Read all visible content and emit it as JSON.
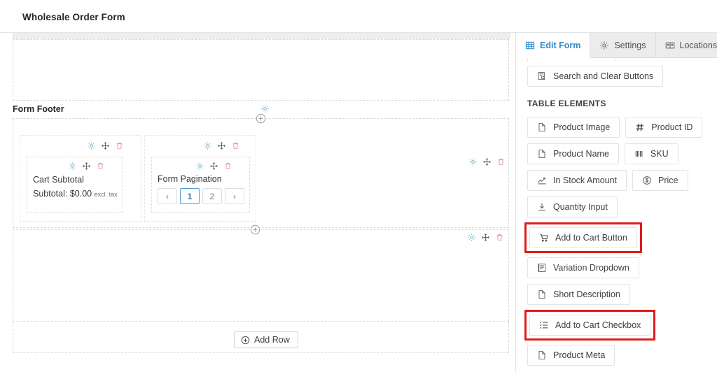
{
  "topbar": {
    "title": "Wholesale Order Form"
  },
  "canvas": {
    "form_footer_label": "Form Footer",
    "cart_subtotal": {
      "title": "Cart Subtotal",
      "value_label": "Subtotal: $0.00",
      "tax_note": "excl. tax"
    },
    "pagination": {
      "title": "Form Pagination",
      "prev": "‹",
      "pages": [
        "1",
        "2"
      ],
      "active_page": "1",
      "next": "›"
    },
    "add_row_label": "Add Row",
    "icons": {
      "settings": "gear-icon",
      "move": "move-icon",
      "delete": "trash-icon",
      "add": "plus-circle-icon"
    }
  },
  "sidebar": {
    "tabs": [
      {
        "label": "Edit Form",
        "icon": "table-grid-icon",
        "active": true
      },
      {
        "label": "Settings",
        "icon": "gear-icon",
        "active": false
      },
      {
        "label": "Locations",
        "icon": "locations-icon",
        "active": false
      }
    ],
    "search_clear_chip": {
      "label": "Search and Clear Buttons",
      "icon": "search-form-icon"
    },
    "table_elements_heading": "TABLE ELEMENTS",
    "elements": [
      {
        "label": "Product Image",
        "icon": "document-icon",
        "highlighted": false
      },
      {
        "label": "Product ID",
        "icon": "hash-icon",
        "highlighted": false
      },
      {
        "label": "Product Name",
        "icon": "document-icon",
        "highlighted": false
      },
      {
        "label": "SKU",
        "icon": "barcode-icon",
        "highlighted": false
      },
      {
        "label": "In Stock Amount",
        "icon": "chart-line-icon",
        "highlighted": false
      },
      {
        "label": "Price",
        "icon": "dollar-coin-icon",
        "highlighted": false
      },
      {
        "label": "Quantity Input",
        "icon": "download-icon",
        "highlighted": false
      },
      {
        "label": "Add to Cart Button",
        "icon": "cart-icon",
        "highlighted": true
      },
      {
        "label": "Variation Dropdown",
        "icon": "dropdown-icon",
        "highlighted": false
      },
      {
        "label": "Short Description",
        "icon": "document-icon",
        "highlighted": false
      },
      {
        "label": "Add to Cart Checkbox",
        "icon": "list-icon",
        "highlighted": true
      },
      {
        "label": "Product Meta",
        "icon": "document-icon",
        "highlighted": false
      }
    ],
    "colors": {
      "accent": "#2e8bc9",
      "highlight": "#e01b1b",
      "gear": "#7fb5cc",
      "trash": "#e29b9b"
    }
  }
}
